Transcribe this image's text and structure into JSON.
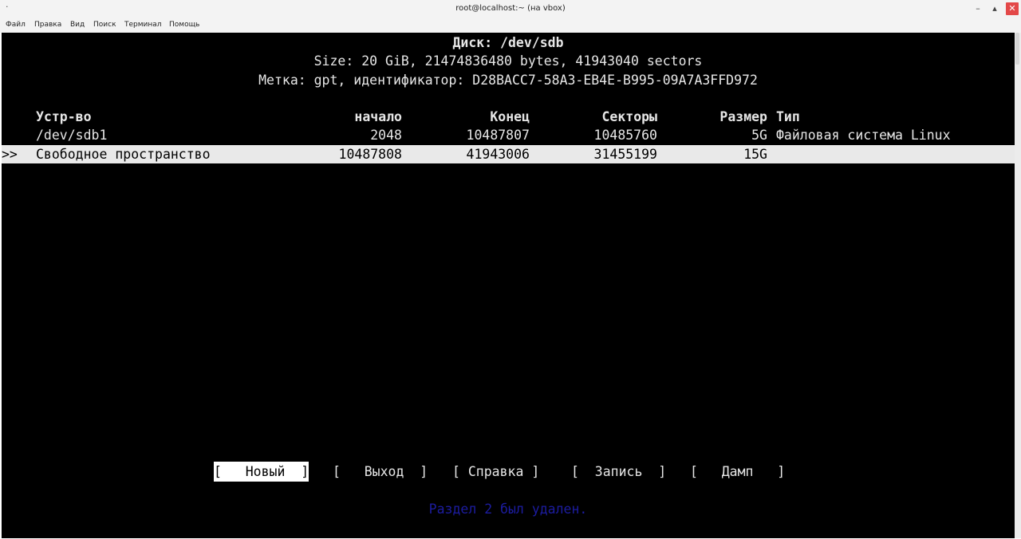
{
  "window": {
    "title": "root@localhost:~ (на vbox)",
    "menu_icon": "·",
    "minimize": "–",
    "maximize": "▴",
    "close": "✕"
  },
  "menu": [
    "Файл",
    "Правка",
    "Вид",
    "Поиск",
    "Терминал",
    "Помощь"
  ],
  "disk": {
    "title": "Диск: /dev/sdb",
    "size_line": "Size: 20 GiB, 21474836480 bytes, 41943040 sectors",
    "label_line": "Метка: gpt, идентификатор: D28BACC7-58A3-EB4E-B995-09A7A3FFD972"
  },
  "table": {
    "headers": {
      "device": "Устр-во",
      "start": "начало",
      "end": "Конец",
      "sectors": "Секторы",
      "size": "Размер",
      "type": "Тип"
    },
    "rows": [
      {
        "marker": "",
        "device": "/dev/sdb1",
        "start": "2048",
        "end": "10487807",
        "sectors": "10485760",
        "size": "5G",
        "type": "Файловая система Linux"
      },
      {
        "marker": ">>",
        "device": "Свободное пространство",
        "start": "10487808",
        "end": "41943006",
        "sectors": "31455199",
        "size": "15G",
        "type": ""
      }
    ]
  },
  "buttons": [
    {
      "label": "[   Новый  ]"
    },
    {
      "label": "[   Выход  ]"
    },
    {
      "label": "[ Справка ]"
    },
    {
      "label": "[  Запись  ]"
    },
    {
      "label": "[   Дамп   ]"
    }
  ],
  "status_message": "Раздел 2 был удален."
}
